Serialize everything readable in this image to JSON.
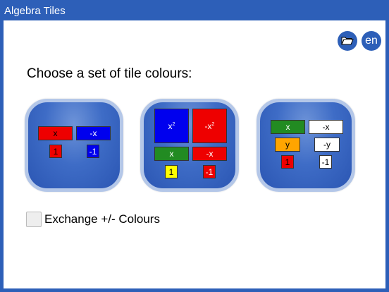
{
  "app": {
    "title": "Algebra Tiles"
  },
  "toolbar": {
    "folder_icon": "folder-open-icon",
    "language": "en"
  },
  "prompt": "Choose a set of tile colours:",
  "tilesets": [
    {
      "tiles": {
        "x": "x",
        "neg_x": "-x",
        "one": "1",
        "neg_one": "-1"
      }
    },
    {
      "tiles": {
        "x2": "x",
        "x2_exp": "2",
        "neg_x2": "-x",
        "neg_x2_exp": "2",
        "x": "x",
        "neg_x": "-x",
        "one": "1",
        "neg_one": "-1"
      }
    },
    {
      "tiles": {
        "x": "x",
        "neg_x": "-x",
        "y": "y",
        "neg_y": "-y",
        "one": "1",
        "neg_one": "-1"
      }
    }
  ],
  "exchange_option": {
    "label": "Exchange +/- Colours",
    "checked": false
  },
  "colors": {
    "accent": "#2d5fb8",
    "red": "#ee0000",
    "blue": "#0000ee",
    "green": "#228b22",
    "yellow": "#ffff00",
    "orange": "#ffa500"
  }
}
